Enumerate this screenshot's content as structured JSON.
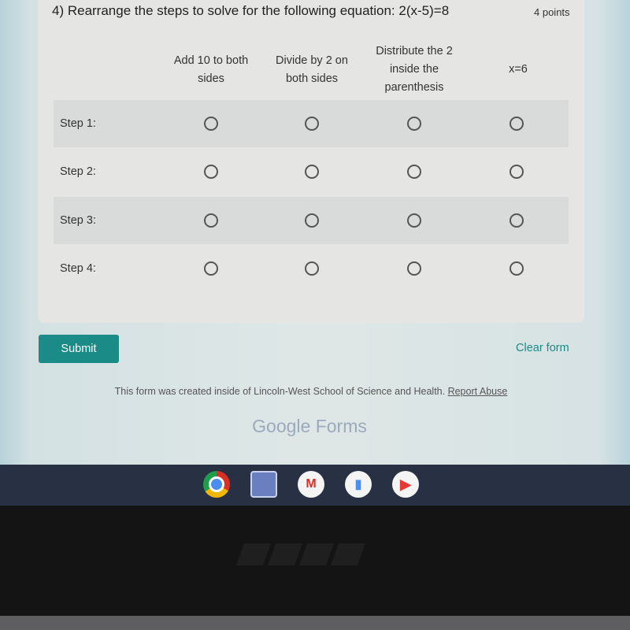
{
  "question": {
    "title": "4) Rearrange the steps to solve for the following equation: 2(x-5)=8",
    "points": "4 points",
    "columns": [
      "Add 10 to both sides",
      "Divide by 2 on both sides",
      "Distribute the 2 inside the parenthesis",
      "x=6"
    ],
    "rows": [
      "Step 1:",
      "Step 2:",
      "Step 3:",
      "Step 4:"
    ]
  },
  "actions": {
    "submit": "Submit",
    "clear": "Clear form"
  },
  "footer": {
    "text": "This form was created inside of Lincoln-West School of Science and Health.",
    "report": "Report Abuse",
    "brand": "Google Forms"
  },
  "taskbar": {
    "icons": [
      "chrome-icon",
      "files-icon",
      "gmail-icon",
      "docs-icon",
      "youtube-icon"
    ]
  },
  "bezel": {
    "logo": "ASUS"
  },
  "colors": {
    "accent": "#1b8b88",
    "taskbar": "#283044"
  }
}
